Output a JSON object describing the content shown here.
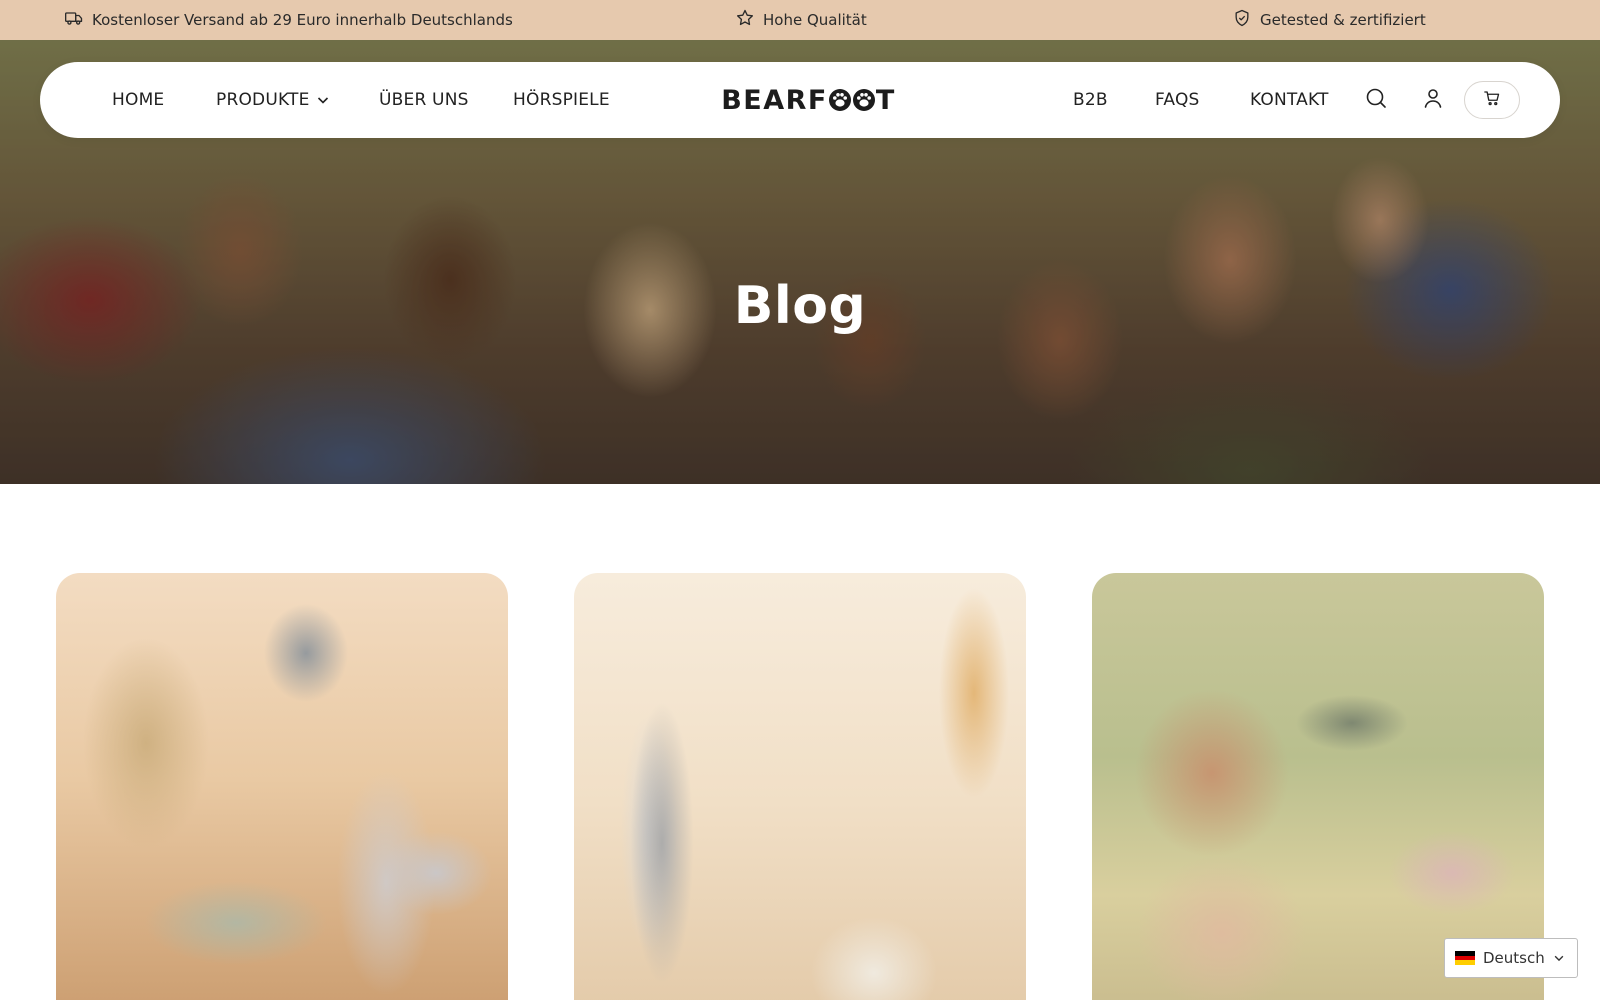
{
  "announcement": {
    "items": [
      {
        "icon": "truck-icon",
        "text": "Kostenloser Versand ab 29 Euro innerhalb Deutschlands"
      },
      {
        "icon": "star-icon",
        "text": "Hohe Qualität"
      },
      {
        "icon": "shield-check-icon",
        "text": "Getested & zertifiziert"
      }
    ],
    "background": "#e6c9ae"
  },
  "header": {
    "logo": {
      "before": "BEARF",
      "after": "T"
    },
    "nav_left": [
      {
        "label": "HOME"
      },
      {
        "label": "PRODUKTE",
        "has_dropdown": true
      },
      {
        "label": "ÜBER UNS"
      },
      {
        "label": "HÖRSPIELE"
      }
    ],
    "nav_right": [
      {
        "label": "B2B"
      },
      {
        "label": "FAQS"
      },
      {
        "label": "KONTAKT"
      }
    ],
    "icons": [
      "search-icon",
      "account-icon",
      "cart-icon"
    ]
  },
  "hero": {
    "title": "Blog"
  },
  "cards": [
    {
      "image": "lunchbox-and-bottles-photo"
    },
    {
      "image": "thermos-and-mug-photo"
    },
    {
      "image": "child-drinking-bottle-photo"
    }
  ],
  "language_selector": {
    "selected": "Deutsch",
    "flag_colors": [
      "#000000",
      "#dd0000",
      "#ffce00"
    ]
  }
}
